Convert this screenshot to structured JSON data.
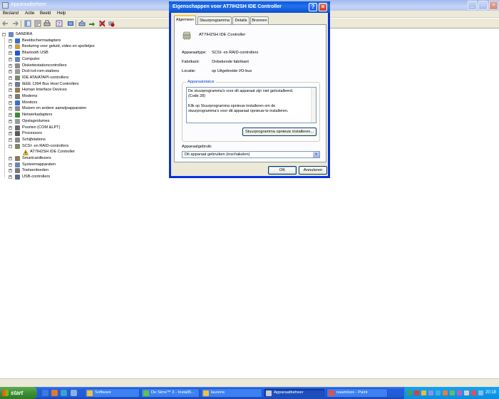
{
  "main_window": {
    "title": "Apparaatbeheer",
    "menu": [
      "Bestand",
      "Actie",
      "Beeld",
      "Help"
    ]
  },
  "tree": {
    "root": "SANDRA",
    "items": [
      {
        "label": "Beeldschermadapters",
        "icon_color": "#3a6fc9"
      },
      {
        "label": "Besturing voor geluid, video en spelletjes",
        "icon_color": "#c9a23a"
      },
      {
        "label": "Bluetooth USB",
        "icon_color": "#1f58d6"
      },
      {
        "label": "Computer",
        "icon_color": "#6a87b5"
      },
      {
        "label": "Diskettestationcontrollers",
        "icon_color": "#8a8a8a"
      },
      {
        "label": "Dvd-/cd-rom-stations",
        "icon_color": "#9a9a9a"
      },
      {
        "label": "IDE ATA/ATAPI-controllers",
        "icon_color": "#7a8a6a"
      },
      {
        "label": "IEEE 1394 Bus Host Controllers",
        "icon_color": "#6a7a9a"
      },
      {
        "label": "Human Interface Devices",
        "icon_color": "#a07a4a"
      },
      {
        "label": "Modems",
        "icon_color": "#7a7a7a"
      },
      {
        "label": "Monitors",
        "icon_color": "#3a6fc9"
      },
      {
        "label": "Muizen en andere aanwijsapparaten",
        "icon_color": "#8a8a8a"
      },
      {
        "label": "Netwerkadapters",
        "icon_color": "#3a8a3a"
      },
      {
        "label": "Opslagvolumes",
        "icon_color": "#9a9a9a"
      },
      {
        "label": "Poorten (COM &LPT)",
        "icon_color": "#6a6a6a"
      },
      {
        "label": "Processors",
        "icon_color": "#5a5a5a"
      },
      {
        "label": "Schijfstations",
        "icon_color": "#8a8a8a"
      },
      {
        "label": "SCSI- en RAID-controllers",
        "icon_color": "#7a8a6a"
      },
      {
        "label": "AT7IH2SH IDE Controller",
        "icon_color": "#e0c020",
        "child": true,
        "warning": true
      },
      {
        "label": "Smartcardlezers",
        "icon_color": "#8a7a5a"
      },
      {
        "label": "Systeemapparaten",
        "icon_color": "#6a87b5"
      },
      {
        "label": "Toetsenborden",
        "icon_color": "#7a7a7a"
      },
      {
        "label": "USB-controllers",
        "icon_color": "#5a6a8a"
      }
    ]
  },
  "dialog": {
    "title": "Eigenschappen voor AT7IH2SH IDE Controller",
    "tabs": [
      "Algemeen",
      "Stuurprogramma",
      "Details",
      "Bronnen"
    ],
    "device_name": "AT7IH2SH IDE Controller",
    "props": [
      {
        "label": "Apparaattype:",
        "value": "SCSI- en RAID-controllers"
      },
      {
        "label": "Fabrikant:",
        "value": "Onbekende fabrikant"
      },
      {
        "label": "Locatie:",
        "value": "op Uitgebreide I/O-bus"
      }
    ],
    "status_group_label": "Apparaatstatus",
    "status_lines": [
      "De stuurprogramma's voor dit apparaat zijn niet geïnstalleerd.",
      "(Code 28)",
      "",
      "Klik op Stuurprogramma opnieuw installeren om de",
      "stuurprogramma's voor dit apparaat opnieuw te installeren."
    ],
    "reinstall_button": "Stuurprogramma opnieuw installeren...",
    "usage_label": "Apparaatgebruik:",
    "usage_value": "Dit apparaat gebruiken (inschakelen)",
    "ok": "OK",
    "cancel": "Annuleren"
  },
  "taskbar": {
    "start": "start",
    "tasks": [
      {
        "label": "Software",
        "icon_color": "#f0c040",
        "active": false
      },
      {
        "label": "De Sims™ 3 - Install5...",
        "icon_color": "#5fc24a",
        "active": false
      },
      {
        "label": "laurens",
        "icon_color": "#f0c040",
        "active": false
      },
      {
        "label": "Apparaatbeheer",
        "icon_color": "#c8c8d8",
        "active": true
      },
      {
        "label": "naamloos - Paint",
        "icon_color": "#e05050",
        "active": false
      }
    ],
    "clock": "20:18"
  },
  "colors": {
    "dialog_title": "#0a5bdf",
    "taskbar": "#245edb",
    "start": "#3c8f34",
    "tray": "#0d8ddf"
  }
}
